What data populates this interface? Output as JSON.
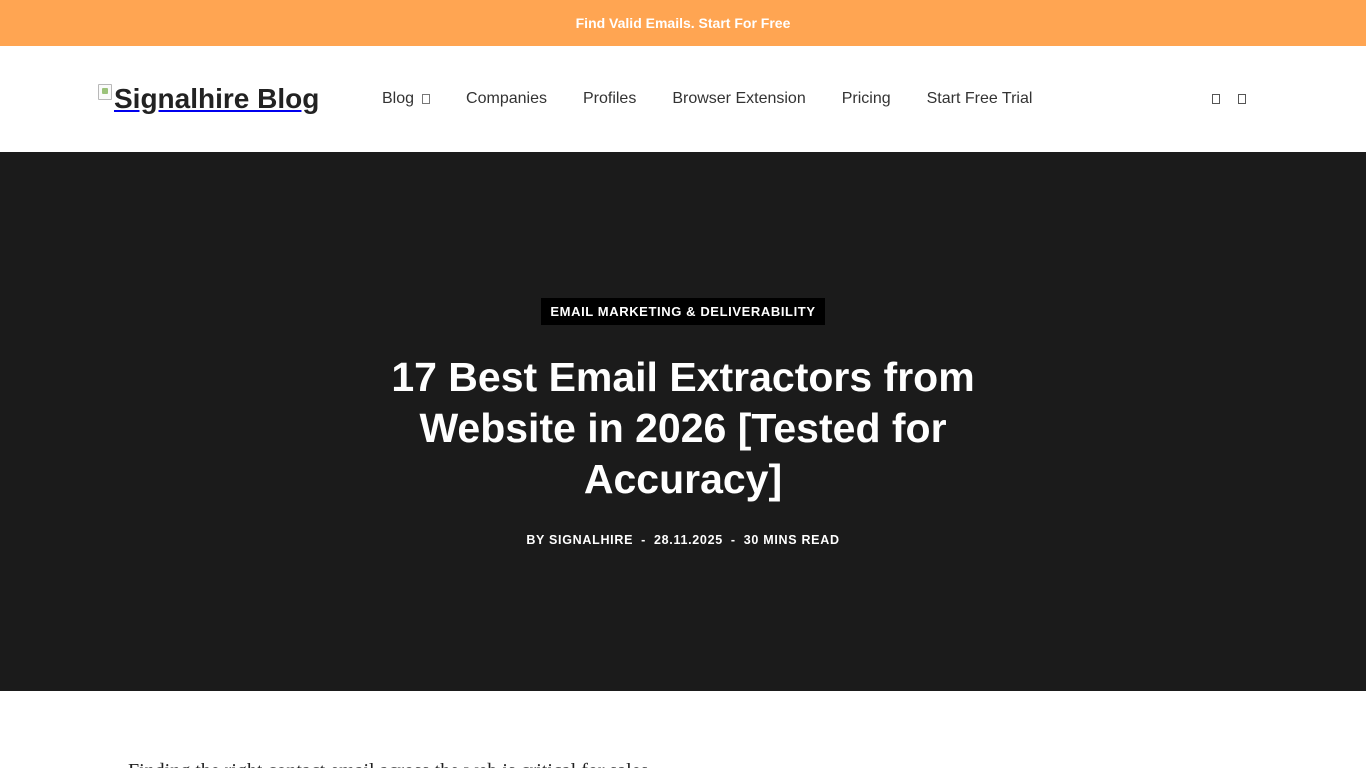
{
  "promo": {
    "text": "Find Valid Emails. Start For Free"
  },
  "header": {
    "logo_alt": "Signalhire Blog",
    "nav": [
      {
        "label": "Blog",
        "has_dropdown": true
      },
      {
        "label": "Companies"
      },
      {
        "label": "Profiles"
      },
      {
        "label": "Browser Extension"
      },
      {
        "label": "Pricing"
      },
      {
        "label": "Start Free Trial"
      }
    ],
    "icons": [
      "search-icon",
      "menu-icon"
    ]
  },
  "hero": {
    "category": "EMAIL MARKETING & DELIVERABILITY",
    "title": "17 Best Email Extractors from Website in 2026 [Tested for Accuracy]",
    "author": "BY SIGNALHIRE",
    "date": "28.11.2025",
    "read_time": "30 MINS READ",
    "separator": "-"
  },
  "article": {
    "intro_partial": "Finding the right contact email across the web is critical for sales"
  },
  "colors": {
    "promo_bg": "#ffa552",
    "hero_bg": "#1b1b1b",
    "badge_bg": "#000000"
  }
}
